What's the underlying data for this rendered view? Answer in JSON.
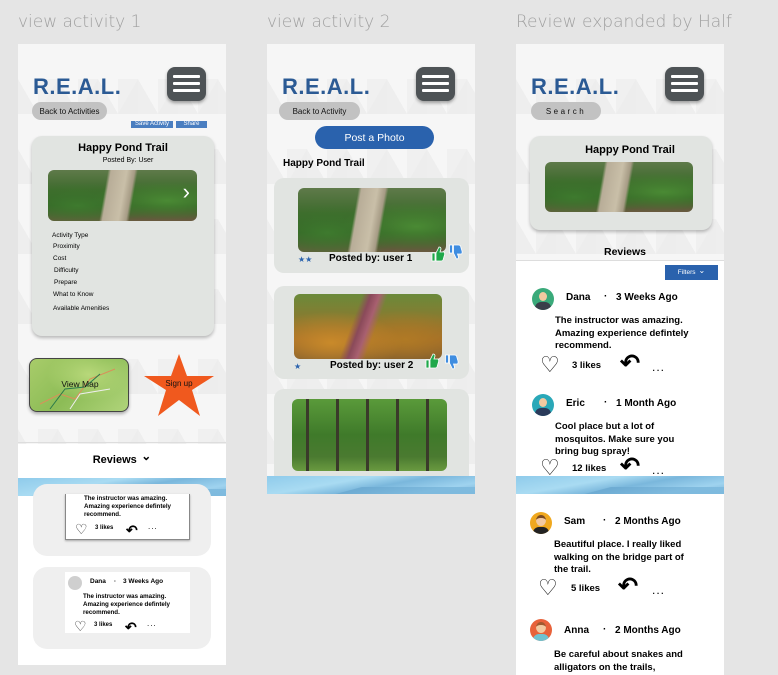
{
  "frames": [
    {
      "label": "view activity 1",
      "logo": "R.E.A.L.",
      "back_button": "Back to Activities",
      "save_activity": "Save Activity",
      "share": "Share",
      "activity": {
        "title": "Happy Pond Trail",
        "posted_by": "Posted By: User",
        "details": [
          "Activity Type",
          "Proximity",
          "Cost",
          "Difficulty",
          "Prepare",
          "What to Know",
          "Available Amenities"
        ]
      },
      "view_map": "View Map",
      "sign_up": "Sign up",
      "reviews_header": "Reviews",
      "reviews": [
        {
          "name": "",
          "time": "",
          "text": [
            "The instructor was amazing.",
            "Amazing experience defintely",
            "recommend."
          ],
          "likes": "3 likes"
        },
        {
          "name": "Dana",
          "time": "3 Weeks Ago",
          "text": [
            "The instructor was amazing.",
            "Amazing experience defintely",
            "recommend."
          ],
          "likes": "3 likes"
        }
      ]
    },
    {
      "label": "view activity 2",
      "logo": "R.E.A.L.",
      "back_button": "Back to Activity",
      "post_photo": "Post a Photo",
      "trail_title": "Happy Pond Trail",
      "posts": [
        {
          "stars": "★★",
          "posted_by": "Posted by: user 1"
        },
        {
          "stars": "★",
          "posted_by": "Posted by: user 2"
        },
        {
          "stars": "",
          "posted_by": ""
        }
      ]
    },
    {
      "label": "Review expanded by Half",
      "logo": "R.E.A.L.",
      "search_button": "Search",
      "trail_title": "Happy Pond Trail",
      "reviews_header": "Reviews",
      "filters": "Filters",
      "reviews": [
        {
          "name": "Dana",
          "time": "3 Weeks Ago",
          "text": [
            "The instructor was amazing.",
            "Amazing experience defintely",
            "recommend."
          ],
          "likes": "3 likes",
          "avatar_color": "#3aaa7a"
        },
        {
          "name": "Eric",
          "time": "1 Month Ago",
          "text": [
            "Cool place but a lot of",
            "mosquitos. Make sure you",
            "bring bug spray!"
          ],
          "likes": "12 likes",
          "avatar_color": "#2aa8b8"
        },
        {
          "name": "Sam",
          "time": "2 Months Ago",
          "text": [
            "Beautiful place. I really liked",
            "walking on the bridge part of",
            "the trail."
          ],
          "likes": "5 likes",
          "avatar_color": "#f0a81e"
        },
        {
          "name": "Anna",
          "time": "2 Months Ago",
          "text": [
            "Be careful about snakes and",
            "alligators on the trails,"
          ],
          "likes": "",
          "avatar_color": "#e8623a"
        }
      ]
    }
  ],
  "icons": {
    "heart": "♡",
    "reply": "↶",
    "more": "...",
    "chevron_down": "⌄",
    "chevron_right": "›",
    "thumbs_up": "👍",
    "thumbs_down": "👎"
  },
  "colors": {
    "brand_blue": "#2b5a94",
    "button_blue": "#2a62ad",
    "sign_up_orange": "#f0591e",
    "thumb_green": "#1fa84a",
    "thumb_blue": "#3f8de0"
  }
}
